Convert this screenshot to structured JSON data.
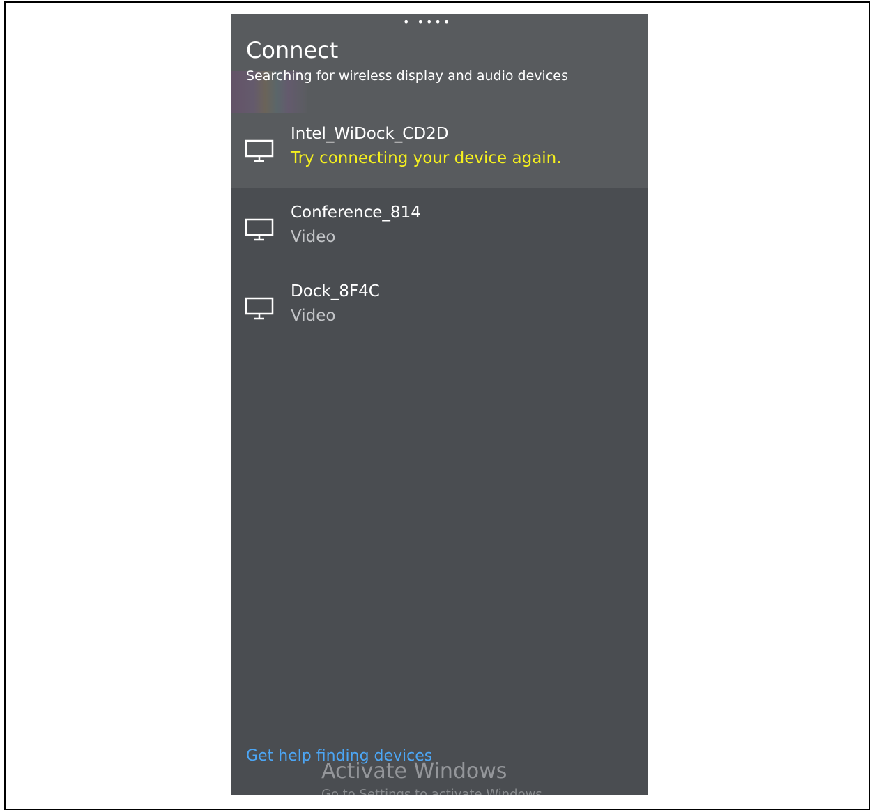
{
  "header": {
    "drag_indicator": "• ••••",
    "title": "Connect",
    "subtitle": "Searching for wireless display and audio devices"
  },
  "devices": [
    {
      "name": "Intel_WiDock_CD2D",
      "status": "Try connecting your device again.",
      "status_color": "#f5f01e",
      "icon": "monitor-icon"
    },
    {
      "name": "Conference_814",
      "status": "Video",
      "icon": "monitor-icon"
    },
    {
      "name": "Dock_8F4C",
      "status": "Video",
      "icon": "monitor-icon"
    }
  ],
  "footer": {
    "help_link": "Get help finding devices"
  },
  "watermark": {
    "title": "Activate Windows",
    "subtitle": "Go to Settings to activate Windows."
  },
  "colors": {
    "panel_background": "#4a4d51",
    "link": "#4ca6f5",
    "warning": "#f5f01e"
  }
}
